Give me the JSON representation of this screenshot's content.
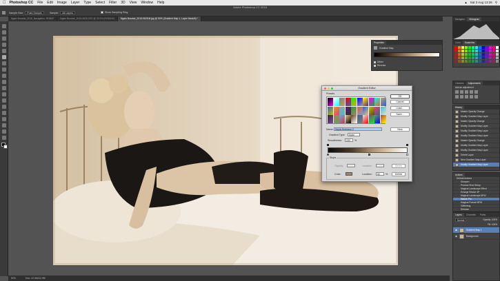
{
  "menubar": {
    "app_name": "Photoshop CC",
    "items": [
      "File",
      "Edit",
      "Image",
      "Layer",
      "Type",
      "Select",
      "Filter",
      "3D",
      "View",
      "Window",
      "Help"
    ],
    "clock": "Sat 3 Aug 13:26"
  },
  "window_title": "Adobe Photoshop CC 2015",
  "options": {
    "sample_size_label": "Sample Size:",
    "sample_size_value": "Point Sample",
    "sample_label": "Sample:",
    "sample_value": "All Layers",
    "show_ring_label": "Show Sampling Ring"
  },
  "tabs": [
    {
      "label": "Ngaio Boudoir_2015_Navigation, RGB/8*",
      "active": false
    },
    {
      "label": "Ngaio Boudoir_2015-0628.CR2 @ 33.3% (RGB/16*)",
      "active": false
    },
    {
      "label": "Ngaio Boudoir_2015-0628.tif.jpg @ 50% (Gradient Map 1, Layer Mask/8) *",
      "active": true
    }
  ],
  "status": {
    "zoom": "50%",
    "doc": "Doc: 22.9M/22.9M"
  },
  "properties": {
    "title": "Properties",
    "subtitle": "Gradient Map",
    "dither": "Dither",
    "reverse": "Reverse"
  },
  "navigator": {
    "tabs": [
      "Navigator",
      "Histogram"
    ]
  },
  "color_panel": {
    "tabs": [
      "Color",
      "Swatches"
    ]
  },
  "adjustments": {
    "tabs": [
      "Libraries",
      "Adjustments"
    ],
    "add_label": "Add an adjustment"
  },
  "history": {
    "title": "History",
    "items": [
      "Master Opacity Change",
      "Modify Gradient Map Layer",
      "Master Opacity Change",
      "Modify Gradient Map Layer",
      "Modify Gradient Map Layer",
      "Modify Gradient Map Layer",
      "Master Opacity Change",
      "Modify Gradient Map Layer",
      "Modify Gradient Map Layer",
      "Delete Layer",
      "New Gradient Map Layer",
      "Modify Gradient Map Layer"
    ],
    "selected_index": 11
  },
  "actions": {
    "title": "Actions",
    "items": [
      "Default Actions",
      "Sharpen",
      "Product Shot Setup",
      "Magical Landscape Effect",
      "Enlarge Resize 4P",
      "Magical Landscape BFW",
      "Nature Pro",
      "Magical Portrait BFW",
      "Glitterbug",
      "Release"
    ],
    "selected_index": 6
  },
  "layers": {
    "tabs": [
      "Layers",
      "Channels",
      "Paths"
    ],
    "mode": "Normal",
    "opacity_label": "Opacity:",
    "opacity": "100%",
    "fill_label": "Fill:",
    "fill": "100%",
    "items": [
      {
        "name": "Gradient Map 1",
        "selected": true
      },
      {
        "name": "Background",
        "selected": false
      }
    ]
  },
  "gradient_editor": {
    "title": "Gradient Editor",
    "presets_label": "Presets",
    "ok": "OK",
    "cancel": "Cancel",
    "load": "Load...",
    "save": "Save...",
    "name_label": "Name:",
    "name_value": "Sepia-Selenium 2",
    "new": "New",
    "type_label": "Gradient Type:",
    "type_value": "Solid",
    "smooth_label": "Smoothness:",
    "smooth_value": "100",
    "smooth_unit": "%",
    "stops_label": "Stops",
    "opacity_label": "Opacity:",
    "opacity_value": "",
    "location_label": "Location:",
    "location_top": "",
    "delete": "Delete",
    "color_label": "Color:",
    "location_bottom": "52",
    "percent": "%",
    "stop_color": "#a38762"
  },
  "preset_colors": [
    "#000000",
    "#ffffff",
    "#808080",
    "#ff0000",
    "#00ff00",
    "#0000ff",
    "#ffff00",
    "#ff00ff",
    "#00ffff",
    "#c8a060",
    "#4060c0",
    "#e0a020",
    "#a0a0a0",
    "#602080",
    "#20a040",
    "#e06020",
    "#2060e0",
    "#c0c000",
    "#e04080",
    "#40c0c0",
    "#303030",
    "#b08060",
    "#80a0e0",
    "#f0c080",
    "#604020",
    "#406080",
    "#e0e0e0",
    "#8040a0",
    "#60a060",
    "#c04040"
  ]
}
